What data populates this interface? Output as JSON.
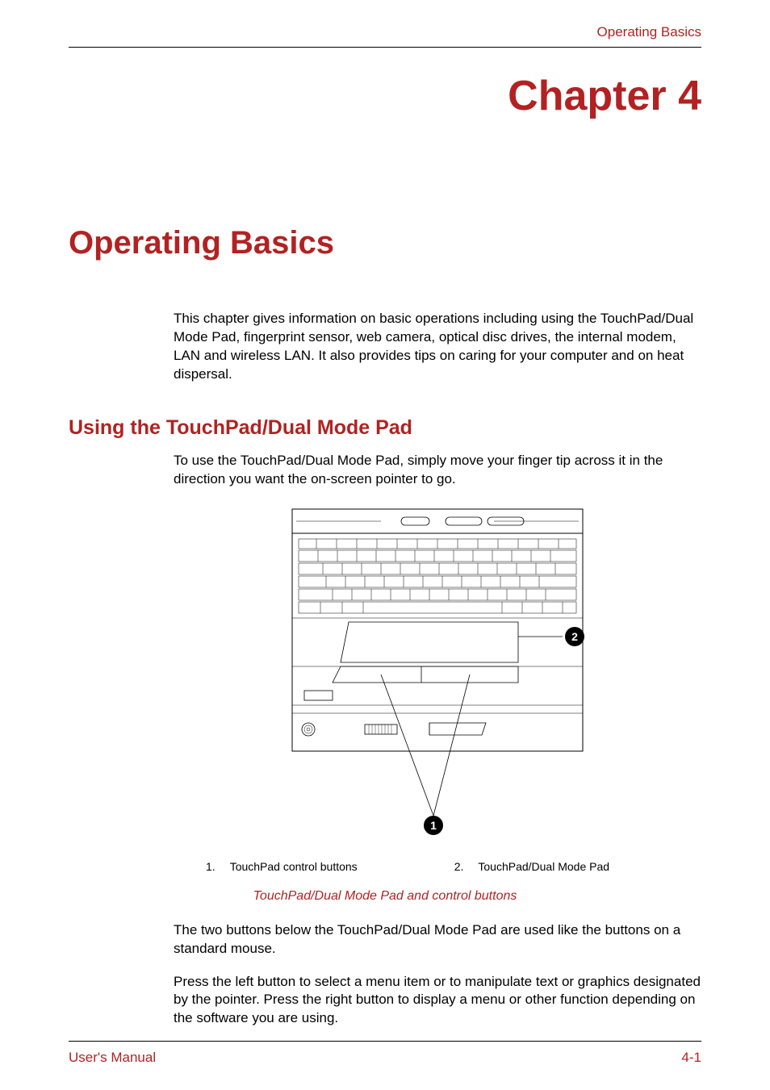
{
  "header": {
    "breadcrumb": "Operating Basics"
  },
  "chapter": {
    "label": "Chapter 4"
  },
  "section": {
    "title": "Operating Basics",
    "intro": "This chapter gives information on basic operations including using the TouchPad/Dual Mode Pad, fingerprint sensor, web camera, optical disc drives, the internal modem, LAN and wireless LAN. It also provides tips on caring for your computer and on heat dispersal."
  },
  "subsection": {
    "title": "Using the TouchPad/Dual Mode Pad",
    "paragraph1": "To use the TouchPad/Dual Mode Pad, simply move your finger tip across it in the direction you want the on-screen pointer to go.",
    "paragraph2": "The two buttons below the TouchPad/Dual Mode Pad are used like the buttons on a standard mouse.",
    "paragraph3": "Press the left button to select a menu item or to manipulate text or graphics designated by the pointer. Press the right button to display a menu or other function depending on the software you are using."
  },
  "figure": {
    "callout1_num": "1",
    "callout2_num": "2",
    "legend1_num": "1.",
    "legend1_text": "TouchPad control buttons",
    "legend2_num": "2.",
    "legend2_text": "TouchPad/Dual Mode Pad",
    "caption": "TouchPad/Dual Mode Pad and control buttons"
  },
  "footer": {
    "manual_label": "User's Manual",
    "page_number": "4-1"
  }
}
